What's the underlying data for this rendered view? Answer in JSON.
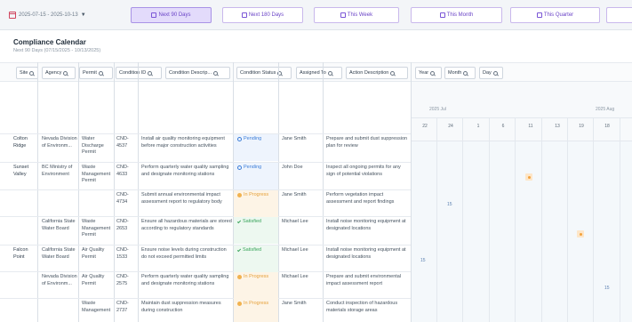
{
  "toolbar": {
    "date_range": "2025-07-15 - 2025-10-13",
    "buttons": [
      "Next 90 Days",
      "Next 180 Days",
      "This Week",
      "This Month",
      "This Quarter"
    ]
  },
  "header": {
    "title": "Compliance Calendar",
    "subtitle": "Next 90 Days (07/15/2025 - 10/13/2025)"
  },
  "filters": [
    "Site",
    "Agency",
    "Permit",
    "Condition ID",
    "Condition Descrip...",
    "Condition Status",
    "Assigned To",
    "Action Description",
    "Year",
    "Month",
    "Day"
  ],
  "timeline": {
    "months": [
      "2025 Jul",
      "2025 Aug"
    ],
    "days": [
      "22",
      "24",
      "1",
      "6",
      "11",
      "13",
      "19",
      "18"
    ]
  },
  "rows": [
    {
      "site": "Colton Ridge",
      "agency": "Nevada Division of Environm...",
      "permit": "Water Discharge Permit",
      "cond_id": "CND-4537",
      "desc": "Install air quality monitoring equipment before major construction activities",
      "status": "Pending",
      "assigned": "Jane Smith",
      "action": "Prepare and submit dust suppression plan for review"
    },
    {
      "site": "Sunset Valley",
      "agency": "BC Ministry of Environment",
      "permit": "Waste Management Permit",
      "cond_id": "CND-4633",
      "desc": "Perform quarterly water quality sampling and designate monitoring stations",
      "status": "Pending",
      "assigned": "John Doe",
      "action": "Inspect all ongoing permits for any sign of potential violations"
    },
    {
      "site": "",
      "agency": "",
      "permit": "",
      "cond_id": "CND-4734",
      "desc": "Submit annual environmental impact assessment report to regulatory body",
      "status": "In Progress",
      "assigned": "Jane Smith",
      "action": "Perform vegetation impact assessment and report findings"
    },
    {
      "site": "",
      "agency": "California State Water Board",
      "permit": "Waste Management Permit",
      "cond_id": "CND-2653",
      "desc": "Ensure all hazardous materials are stored according to regulatory standards",
      "status": "Satisfied",
      "assigned": "Michael Lee",
      "action": "Install noise monitoring equipment at designated locations"
    },
    {
      "site": "Falcon Point",
      "agency": "California State Water Board",
      "permit": "Air Quality Permit",
      "cond_id": "CND-1533",
      "desc": "Ensure noise levels during construction do not exceed permitted limits",
      "status": "Satisfied",
      "assigned": "Michael Lee",
      "action": "Install noise monitoring equipment at designated locations"
    },
    {
      "site": "",
      "agency": "Nevada Division of Environm...",
      "permit": "Air Quality Permit",
      "cond_id": "CND-2575",
      "desc": "Perform quarterly water quality sampling and designate monitoring stations",
      "status": "In Progress",
      "assigned": "Michael Lee",
      "action": "Prepare and submit environmental impact assessment report"
    },
    {
      "site": "",
      "agency": "",
      "permit": "Waste Management",
      "cond_id": "CND-2737",
      "desc": "Maintain dust suppression measures during construction",
      "status": "In Progress",
      "assigned": "Jane Smith",
      "action": "Conduct inspection of hazardous materials storage areas"
    }
  ],
  "timeline_markers": [
    "15",
    "15",
    "15"
  ]
}
